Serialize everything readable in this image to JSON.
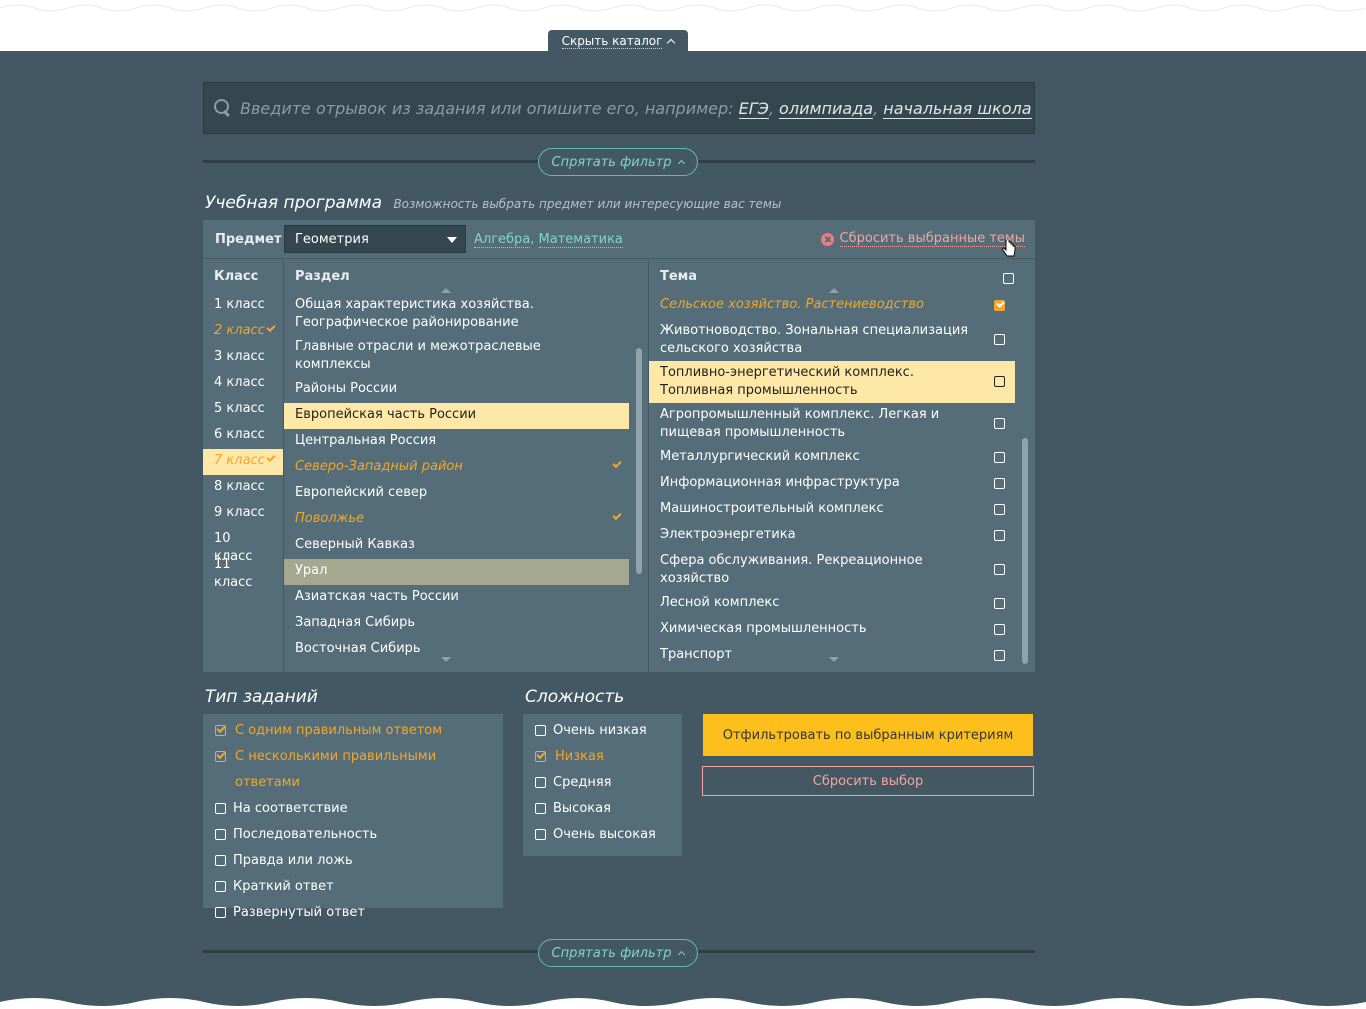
{
  "catalog_toggle": {
    "label": "Скрыть каталог"
  },
  "search": {
    "placeholder": "Введите отрывок из задания или опишите его, например:",
    "examples": [
      "ЕГЭ",
      "олимпиада",
      "начальная школа"
    ]
  },
  "hide_filter_label": "Спрятать фильтр",
  "program": {
    "title": "Учебная программа",
    "subtitle": "Возможность выбрать предмет или интересующие вас темы",
    "subject_label": "Предмет",
    "subject_value": "Геометрия",
    "related": [
      "Алгебра",
      "Математика"
    ],
    "reset_topics": "Сбросить выбранные темы",
    "class_header": "Класс",
    "section_header": "Раздел",
    "topic_header": "Тема",
    "classes": [
      {
        "label": "1 класс",
        "state": "normal"
      },
      {
        "label": "2 класс",
        "state": "selected"
      },
      {
        "label": "3 класс",
        "state": "normal"
      },
      {
        "label": "4 класс",
        "state": "normal"
      },
      {
        "label": "5 класс",
        "state": "normal"
      },
      {
        "label": "6 класс",
        "state": "normal"
      },
      {
        "label": "7 класс",
        "state": "highlight-selected"
      },
      {
        "label": "8 класс",
        "state": "normal"
      },
      {
        "label": "9 класс",
        "state": "normal"
      },
      {
        "label": "10 класс",
        "state": "normal"
      },
      {
        "label": "11 класс",
        "state": "normal"
      }
    ],
    "sections": [
      {
        "label": "Общая характеристика хозяйства. Географическое районирование",
        "state": "normal"
      },
      {
        "label": "Главные отрасли и межотраслевые комплексы",
        "state": "normal"
      },
      {
        "label": "Районы России",
        "state": "normal"
      },
      {
        "label": "Европейская часть России",
        "state": "highlight"
      },
      {
        "label": "Центральная Россия",
        "state": "normal"
      },
      {
        "label": "Северо-Западный район",
        "state": "selected"
      },
      {
        "label": "Европейский север",
        "state": "normal"
      },
      {
        "label": "Поволжье",
        "state": "selected"
      },
      {
        "label": "Северный Кавказ",
        "state": "normal"
      },
      {
        "label": "Урал",
        "state": "hover"
      },
      {
        "label": "Азиатская часть России",
        "state": "normal"
      },
      {
        "label": "Западная Сибирь",
        "state": "normal"
      },
      {
        "label": "Восточная Сибирь",
        "state": "normal"
      }
    ],
    "topics": [
      {
        "label": "Сельское хозяйство. Растениеводство",
        "state": "selected",
        "checked": true
      },
      {
        "label": "Животноводство. Зональная специализация сельского хозяйства",
        "state": "normal",
        "checked": false
      },
      {
        "label": "Топливно-энергетический комплекс. Топливная промышленность",
        "state": "highlight",
        "checked": false
      },
      {
        "label": "Агропромышленный комплекс. Легкая и пищевая промышленность",
        "state": "normal",
        "checked": false
      },
      {
        "label": "Металлургический комплекс",
        "state": "normal",
        "checked": false
      },
      {
        "label": "Информационная инфраструктура",
        "state": "normal",
        "checked": false
      },
      {
        "label": "Машиностроительный комплекс",
        "state": "normal",
        "checked": false
      },
      {
        "label": "Электроэнергетика",
        "state": "normal",
        "checked": false
      },
      {
        "label": "Сфера обслуживания. Рекреационное хозяйство",
        "state": "normal",
        "checked": false
      },
      {
        "label": "Лесной комплекс",
        "state": "normal",
        "checked": false
      },
      {
        "label": "Химическая промышленность",
        "state": "normal",
        "checked": false
      },
      {
        "label": "Транспорт",
        "state": "normal",
        "checked": false
      }
    ]
  },
  "task_types": {
    "title": "Тип заданий",
    "options": [
      {
        "label": "С одним правильным ответом",
        "checked": true
      },
      {
        "label": "С несколькими правильными ответами",
        "checked": true
      },
      {
        "label": "На соответствие",
        "checked": false
      },
      {
        "label": "Последовательность",
        "checked": false
      },
      {
        "label": "Правда или ложь",
        "checked": false
      },
      {
        "label": "Краткий ответ",
        "checked": false
      },
      {
        "label": "Развернутый ответ",
        "checked": false
      }
    ]
  },
  "difficulty": {
    "title": "Сложность",
    "options": [
      {
        "label": "Очень низкая",
        "checked": false
      },
      {
        "label": "Низкая",
        "checked": true
      },
      {
        "label": "Средняя",
        "checked": false
      },
      {
        "label": "Высокая",
        "checked": false
      },
      {
        "label": "Очень высокая",
        "checked": false
      }
    ]
  },
  "actions": {
    "apply": "Отфильтровать по выбранным критериям",
    "reset": "Сбросить выбор"
  },
  "colors": {
    "background": "#435863",
    "panel": "#546d78",
    "accent_orange": "#f5a623",
    "apply_button": "#fdbf1c",
    "teal": "#7fd6cc",
    "reset_pink": "#f4a5a0",
    "highlight_row": "#fde8a7"
  }
}
